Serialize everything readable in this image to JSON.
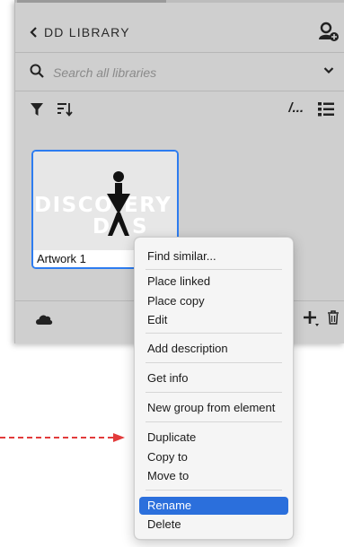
{
  "panel": {
    "back_label": "DD LIBRARY",
    "search": {
      "placeholder": "Search all libraries",
      "value": ""
    },
    "toolbar": {
      "path_label": "/..."
    },
    "card": {
      "caption": "Artwork 1",
      "thumbnail_text_line1": "DISCOVERY",
      "thumbnail_text_line2": "DAYS"
    }
  },
  "context_menu": {
    "items": [
      "Find similar...",
      "Place linked",
      "Place copy",
      "Edit",
      "Add description",
      "Get info",
      "New group from element",
      "Duplicate",
      "Copy to",
      "Move to",
      "Rename",
      "Delete"
    ],
    "selected": "Rename"
  },
  "colors": {
    "panel_bg": "#cfcfcf",
    "selection": "#2b6fdc",
    "card_border": "#2d7cf0",
    "annotation_arrow": "#e23b3b"
  },
  "icons": [
    "chevron-left-icon",
    "add-user-icon",
    "search-icon",
    "chevron-down-icon",
    "filter-icon",
    "sort-icon",
    "list-view-icon",
    "cloud-icon",
    "plus-icon",
    "trash-icon"
  ]
}
